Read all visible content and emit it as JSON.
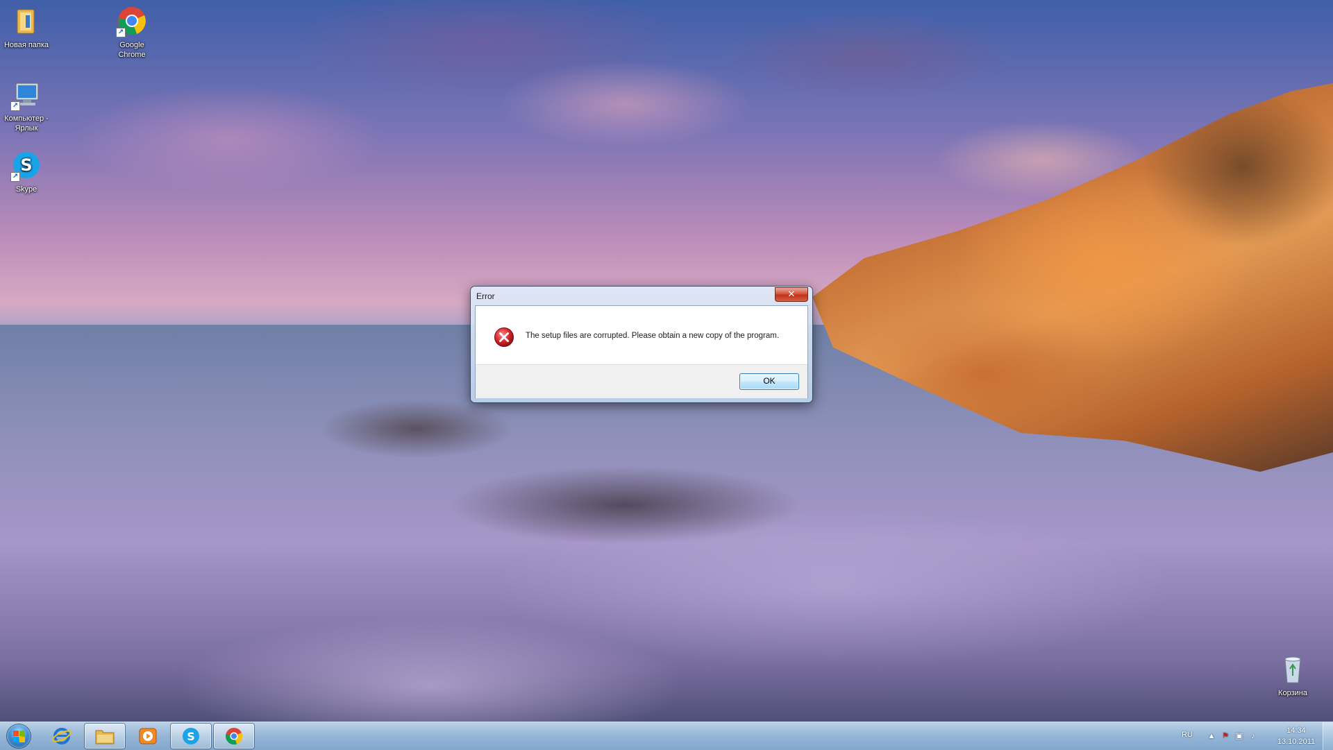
{
  "desktop": {
    "icons": [
      {
        "label": "Новая папка",
        "icon": "folder-icon"
      },
      {
        "label": "Google Chrome",
        "icon": "chrome-icon"
      },
      {
        "label": "Компьютер - Ярлык",
        "icon": "computer-icon"
      },
      {
        "label": "Skype",
        "icon": "skype-icon"
      },
      {
        "label": "Корзина",
        "icon": "recycle-bin-icon"
      }
    ]
  },
  "dialog": {
    "title": "Error",
    "close_label": "✕",
    "message": "The setup files are corrupted. Please obtain a new copy of the program.",
    "ok_label": "OK",
    "icon": "error-icon"
  },
  "taskbar": {
    "pinned": [
      {
        "name": "internet-explorer",
        "icon": "ie-icon",
        "active": false
      },
      {
        "name": "windows-explorer",
        "icon": "folder-icon",
        "active": true
      },
      {
        "name": "media-player",
        "icon": "media-player-icon",
        "active": false
      },
      {
        "name": "skype",
        "icon": "skype-icon",
        "active": true
      },
      {
        "name": "google-chrome",
        "icon": "chrome-icon",
        "active": true
      }
    ],
    "tray": {
      "language": "RU",
      "time": "14:34",
      "date": "13.10.2011"
    }
  },
  "colors": {
    "dialog_close": "#c0321a",
    "ok_border": "#3c7fb1",
    "error_red": "#d6262a"
  }
}
